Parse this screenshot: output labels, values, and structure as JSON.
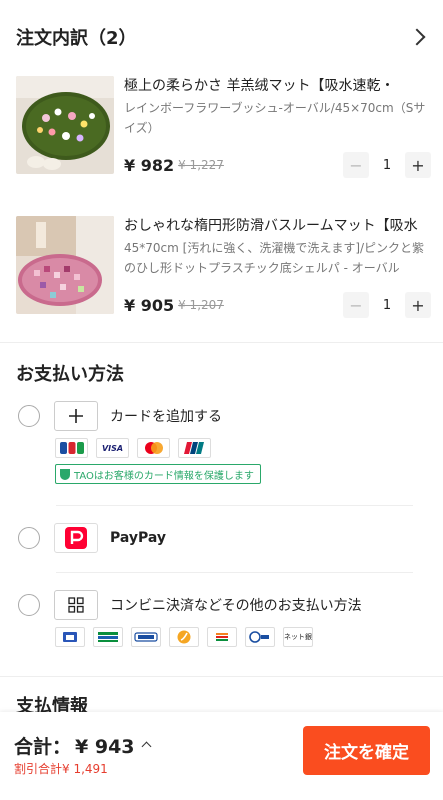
{
  "order": {
    "title": "注文内訳（2）",
    "items": [
      {
        "title": "極上の柔らかさ 羊羔绒マット【吸水速乾・",
        "variant": "レインボーフラワーブッシュ-オーバル/45×70cm（Sサイズ）",
        "price": "¥ 982",
        "original_price": "¥ 1,227",
        "quantity": "1"
      },
      {
        "title": "おしゃれな楕円形防滑バスルームマット【吸水",
        "variant": "45*70cm [汚れに強く、洗濯機で洗えます]/ピンクと紫のひし形ドットプラスチック底シェルパ - オーバル",
        "price": "¥ 905",
        "original_price": "¥ 1,207",
        "quantity": "1"
      }
    ],
    "stepper": {
      "minus": "−",
      "plus": "+"
    }
  },
  "payment": {
    "title": "お支払い方法",
    "options": [
      {
        "label": "カードを追加する",
        "icon": "plus-icon"
      },
      {
        "label": "PayPay",
        "icon": "paypay-logo"
      },
      {
        "label": "コンビニ決済などその他のお支払い方法",
        "icon": "grid-icon"
      }
    ],
    "card_brands": [
      "JCB",
      "VISA",
      "mastercard",
      "UnionPay"
    ],
    "protect_text": "TAOはお客様のカード情報を保護します",
    "convenience_stores": [
      "Lawson",
      "FamilyMart",
      "MINISTOP",
      "Seicomart",
      "7-Eleven",
      "Pay-easy",
      "ネット銀"
    ]
  },
  "next_section_title": "支払情報",
  "footer": {
    "total_label": "合計：",
    "total_value": "¥ 943",
    "discount_text": "割引合計¥ 1,491",
    "confirm_label": "注文を確定"
  },
  "colors": {
    "accent": "#fa4d1f",
    "discount": "#e63d2e",
    "protect_green": "#2aa86a"
  }
}
